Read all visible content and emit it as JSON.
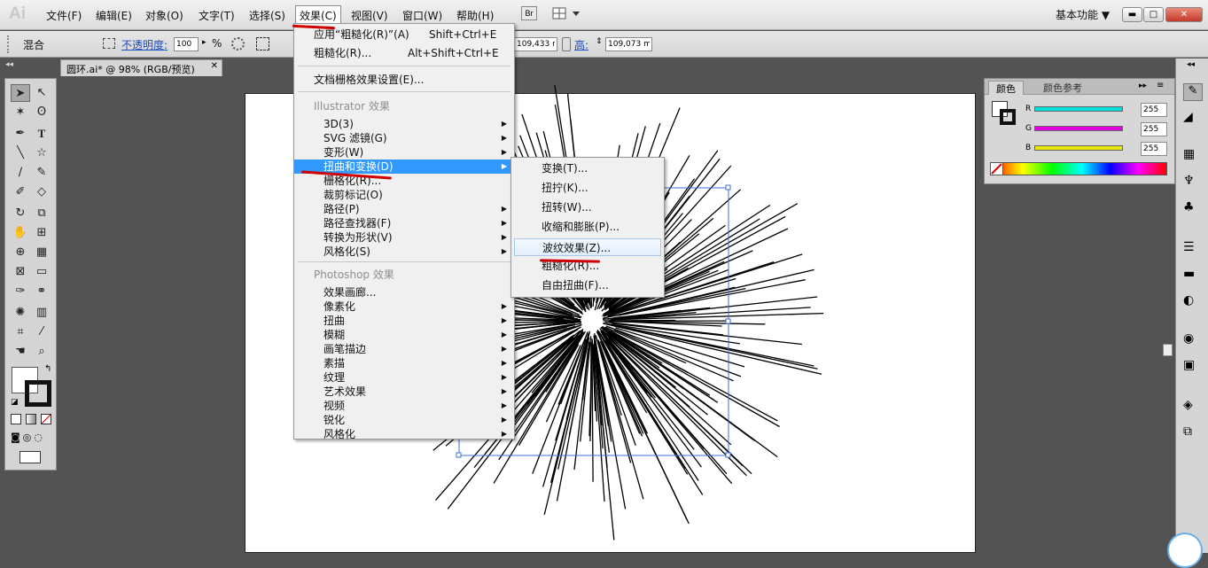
{
  "app": {
    "logo": "Ai"
  },
  "menubar": [
    {
      "label": "文件(F)"
    },
    {
      "label": "编辑(E)"
    },
    {
      "label": "对象(O)"
    },
    {
      "label": "文字(T)"
    },
    {
      "label": "选择(S)"
    },
    {
      "label": "效果(C)"
    },
    {
      "label": "视图(V)"
    },
    {
      "label": "窗口(W)"
    },
    {
      "label": "帮助(H)"
    }
  ],
  "bridge": "Br",
  "workspace": "基本功能",
  "window_controls": {
    "minimize": "▬",
    "maximize": "□",
    "close": "✕"
  },
  "control": {
    "blend": "混合",
    "opacity_label": "不透明度:",
    "opacity_value": "100",
    "percent": "%",
    "w_value": "109,433 mi",
    "h_label": "高:",
    "h_value": "109,073 mi"
  },
  "document_tab": "圆环.ai* @ 98% (RGB/预览)",
  "effect_menu": {
    "items": [
      {
        "label": "应用“粗糙化(R)”(A)",
        "shortcut": "Shift+Ctrl+E"
      },
      {
        "label": "粗糙化(R)...",
        "shortcut": "Alt+Shift+Ctrl+E"
      },
      {
        "label": "文档栅格效果设置(E)..."
      },
      {
        "label": "Illustrator 效果"
      },
      {
        "label": "3D(3)"
      },
      {
        "label": "SVG 滤镜(G)"
      },
      {
        "label": "变形(W)"
      },
      {
        "label": "扭曲和变换(D)"
      },
      {
        "label": "栅格化(R)..."
      },
      {
        "label": "裁剪标记(O)"
      },
      {
        "label": "路径(P)"
      },
      {
        "label": "路径查找器(F)"
      },
      {
        "label": "转换为形状(V)"
      },
      {
        "label": "风格化(S)"
      },
      {
        "label": "Photoshop 效果"
      },
      {
        "label": "效果画廊..."
      },
      {
        "label": "像素化"
      },
      {
        "label": "扭曲"
      },
      {
        "label": "模糊"
      },
      {
        "label": "画笔描边"
      },
      {
        "label": "素描"
      },
      {
        "label": "纹理"
      },
      {
        "label": "艺术效果"
      },
      {
        "label": "视频"
      },
      {
        "label": "锐化"
      },
      {
        "label": "风格化"
      }
    ]
  },
  "distort_submenu": {
    "items": [
      {
        "label": "变换(T)..."
      },
      {
        "label": "扭拧(K)..."
      },
      {
        "label": "扭转(W)..."
      },
      {
        "label": "收缩和膨胀(P)..."
      },
      {
        "label": "波纹效果(Z)..."
      },
      {
        "label": "粗糙化(R)..."
      },
      {
        "label": "自由扭曲(F)..."
      }
    ]
  },
  "color_panel": {
    "tabs": [
      "颜色",
      "颜色参考"
    ],
    "channels": [
      {
        "name": "R",
        "value": "255",
        "color": "#00dede"
      },
      {
        "name": "G",
        "value": "255",
        "color": "#e000e0"
      },
      {
        "name": "B",
        "value": "255",
        "color": "#e8e800"
      }
    ]
  },
  "colors": {
    "highlight": "#3399ff",
    "annotation": "#d10000"
  }
}
